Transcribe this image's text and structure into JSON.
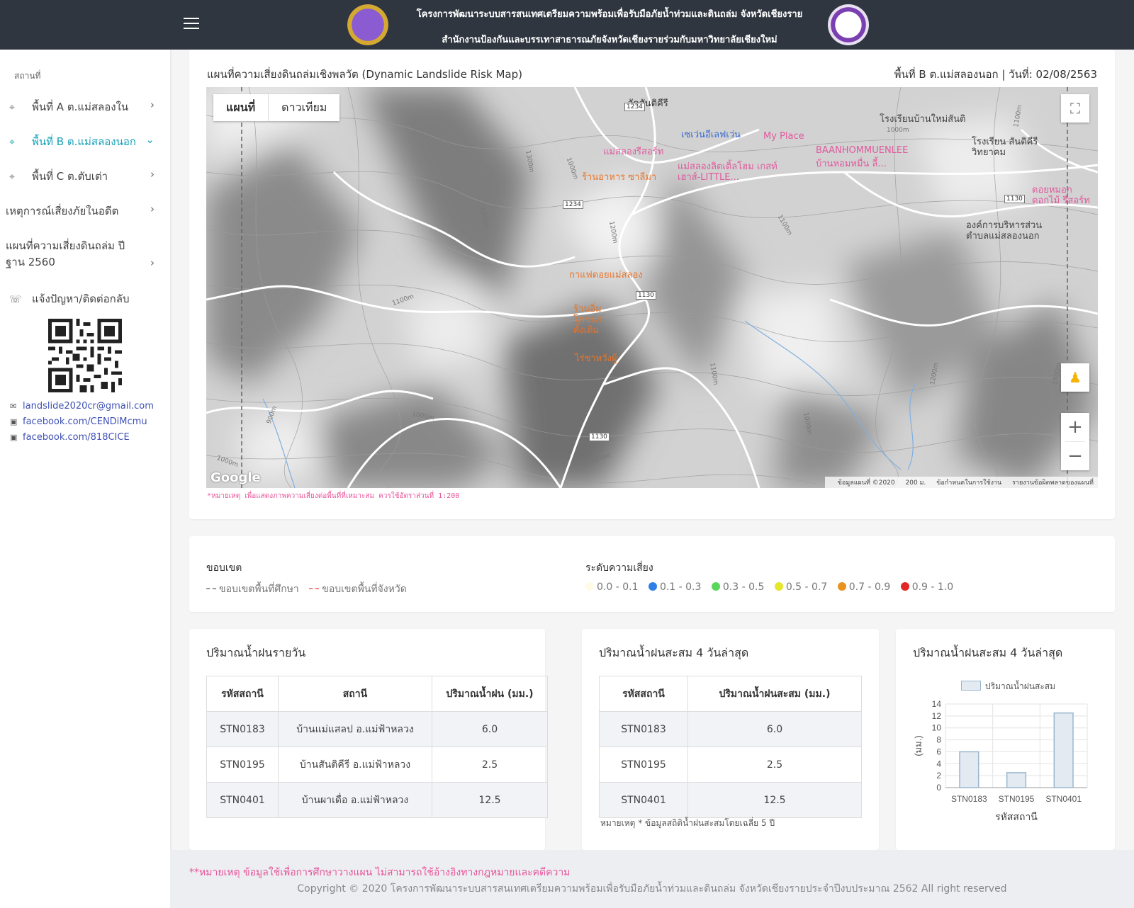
{
  "header": {
    "title_line1": "โครงการพัฒนาระบบสารสนเทศเตรียมความพร้อมเพื่อรับมือภัยน้ำท่วมและดินถล่ม จังหวัดเชียงราย",
    "title_line2": "สำนักงานป้องกันและบรรเทาสาธารณภัยจังหวัดเชียงรายร่วมกับมหาวิทยาลัยเชียงใหม่"
  },
  "sidebar": {
    "heading": "สถานที่",
    "items": [
      {
        "label": "พื้นที่ A ต.แม่สลองใน",
        "icon": "map-pin-icon"
      },
      {
        "label": "พื้นที่ B ต.แม่สลองนอก",
        "icon": "map-pin-icon"
      },
      {
        "label": "พื้นที่ C ต.ตับเต่า",
        "icon": "map-pin-icon"
      },
      {
        "label": "เหตุการณ์เสี่ยงภัยในอดีต"
      },
      {
        "label": "แผนที่ความเสี่ยงดินถล่ม ปีฐาน 2560"
      },
      {
        "label": "แจ้งปัญหา/ติดต่อกลับ",
        "icon": "phone-icon"
      }
    ],
    "contacts": [
      {
        "icon": "mail-icon",
        "text": "landslide2020cr@gmail.com"
      },
      {
        "icon": "facebook-icon",
        "text": "facebook.com/CENDiMcmu"
      },
      {
        "icon": "facebook-icon",
        "text": "facebook.com/818CICE"
      }
    ]
  },
  "map_card": {
    "title": "แผนที่ความเสี่ยงดินถล่มเชิงพลวัต (Dynamic Landslide Risk Map)",
    "area_date": "พื้นที่ B ต.แม่สลองนอก | วันที่: 02/08/2563",
    "toggle_map": "แผนที่",
    "toggle_satellite": "ดาวเทียม",
    "google": "Google",
    "attribution": [
      "ข้อมูลแผนที่ ©2020",
      "200 ม.",
      "ข้อกำหนดในการใช้งาน",
      "รายงานข้อผิดพลาดของแผนที่"
    ],
    "note": "*หมายเหตุ เพื่อแสดงภาพความเสี่ยงต่อพื้นที่ที่เหมาะสม ควรใช้อัตราส่วนที่ 1:200",
    "places": [
      "วัดสันติคีรี",
      "เซเว่นอีเลฟเว่น",
      "My Place",
      "โรงเรียนบ้านใหม่สันติ",
      "โรงเรียน สันติคีรีวิทยาคม",
      "แม่สลองรีสอร์ท",
      "แม่สลองลิตเติ้ลโฮม เกสท์เฮาส์-LITTLE...",
      "BAANHOMMUENLEE",
      "บ้านหอมหมื่น ลี้...",
      "ร้านอาหาร ซาลีมา",
      "ดอยหมอก ดอกไม้ รีสอร์ท",
      "องค์การบริหารส่วนตำบลแม่สลองนอก",
      "กาแฟดอยแม่สลอง",
      "ร้านอิ่ม โภชนา ดั้งเดิม",
      "ไร่ชาหวังผู้"
    ],
    "roads": [
      "1234",
      "1234",
      "1130",
      "1130",
      "1130"
    ],
    "contours": [
      "1300m",
      "1200m",
      "1200m",
      "1100m",
      "1100m",
      "1000m",
      "1000m",
      "900m",
      "1000m",
      "1100m",
      "1200m",
      "1100m",
      "1000m",
      "1000m",
      "1100m",
      "1000m"
    ]
  },
  "legend": {
    "boundary_title": "ขอบเขต",
    "boundary_items": [
      "ขอบเขตพื้นที่ศึกษา",
      "ขอบเขตพื้นที่จังหวัด"
    ],
    "risk_title": "ระดับความเสี่ยง",
    "risk_levels": [
      {
        "label": "0.0 - 0.1",
        "color": "#fffbe6"
      },
      {
        "label": "0.1 - 0.3",
        "color": "#2f7fe8"
      },
      {
        "label": "0.3 - 0.5",
        "color": "#5ad65a"
      },
      {
        "label": "0.5 - 0.7",
        "color": "#e6e62a"
      },
      {
        "label": "0.7 - 0.9",
        "color": "#e8931e"
      },
      {
        "label": "0.9 - 1.0",
        "color": "#e32626"
      }
    ]
  },
  "daily_rain": {
    "title": "ปริมาณน้ำฝนรายวัน",
    "headers": [
      "รหัสสถานี",
      "สถานี",
      "ปริมาณน้ำฝน (มม.)"
    ],
    "rows": [
      [
        "STN0183",
        "บ้านแม่แสลป อ.แม่ฟ้าหลวง",
        "6.0"
      ],
      [
        "STN0195",
        "บ้านสันติคีรี อ.แม่ฟ้าหลวง",
        "2.5"
      ],
      [
        "STN0401",
        "บ้านผาเดื่อ อ.แม่ฟ้าหลวง",
        "12.5"
      ]
    ]
  },
  "cumulative_rain": {
    "title": "ปริมาณน้ำฝนสะสม 4 วันล่าสุด",
    "headers": [
      "รหัสสถานี",
      "ปริมาณน้ำฝนสะสม (มม.)"
    ],
    "rows": [
      [
        "STN0183",
        "6.0"
      ],
      [
        "STN0195",
        "2.5"
      ],
      [
        "STN0401",
        "12.5"
      ]
    ],
    "note": "หมายเหตุ * ข้อมูลสถิติน้ำฝนสะสมโดยเฉลี่ย 5 ปี"
  },
  "chart_card": {
    "title": "ปริมาณน้ำฝนสะสม 4 วันล่าสุด"
  },
  "chart_data": {
    "type": "bar",
    "categories": [
      "STN0183",
      "STN0195",
      "STN0401"
    ],
    "series": [
      {
        "name": "ปริมาณน้ำฝนสะสม",
        "values": [
          6.0,
          2.5,
          12.5
        ]
      }
    ],
    "xlabel": "รหัสสถานี",
    "ylabel": "(มม.)",
    "ylim": [
      0,
      14
    ],
    "yticks": [
      0,
      2,
      4,
      6,
      8,
      10,
      12,
      14
    ],
    "grid": true,
    "legend": "top",
    "bar_fill": "#e3eaf2",
    "bar_stroke": "#9bb5cc"
  },
  "footer": {
    "note": "**หมายเหตุ ข้อมูลใช้เพื่อการศึกษาวางแผน ไม่สามารถใช้อ้างอิงทางกฎหมายและคดีความ",
    "copyright": "Copyright © 2020 โครงการพัฒนาระบบสารสนเทศเตรียมความพร้อมเพื่อรับมือภัยน้ำท่วมและดินถล่ม จังหวัดเชียงรายประจำปีงบประมาณ 2562 All right reserved"
  }
}
